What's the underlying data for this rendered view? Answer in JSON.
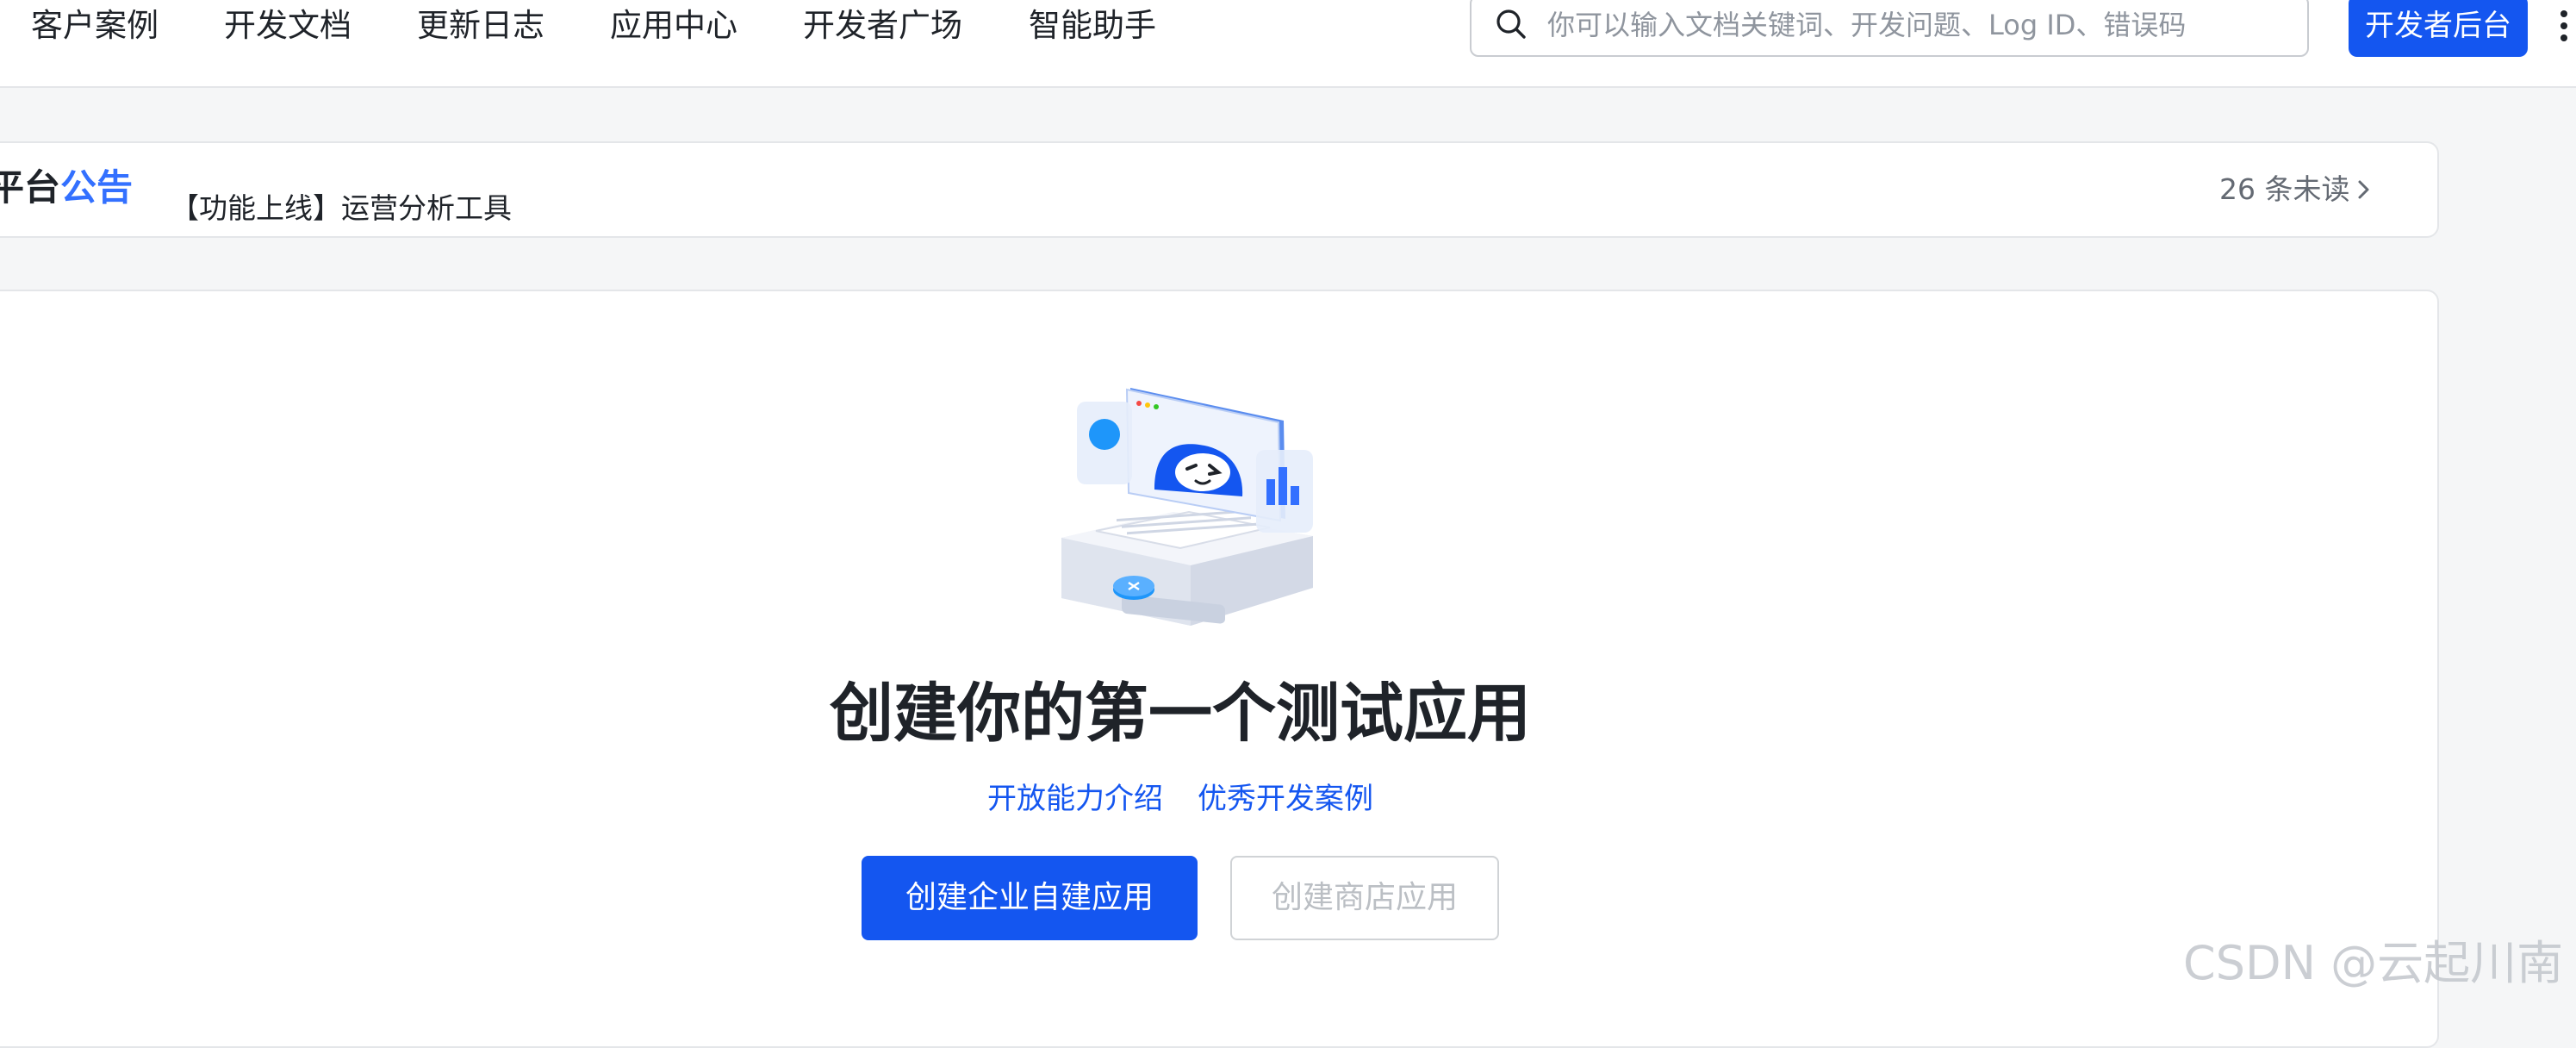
{
  "nav": {
    "items": [
      "客户案例",
      "开发文档",
      "更新日志",
      "应用中心",
      "开发者广场",
      "智能助手"
    ]
  },
  "search": {
    "placeholder": "你可以输入文档关键词、开发问题、Log ID、错误码",
    "value": ""
  },
  "header": {
    "console_label": "开发者后台"
  },
  "announcement": {
    "title_part1": "平台",
    "title_part2": "公告",
    "item": "【功能上线】运营分析工具",
    "unread": "26 条未读"
  },
  "empty_state": {
    "title": "创建你的第一个测试应用",
    "links": [
      "开放能力介绍",
      "优秀开发案例"
    ],
    "primary_button": "创建企业自建应用",
    "secondary_button": "创建商店应用"
  },
  "watermark": "CSDN @云起川南",
  "colors": {
    "brand": "#1456f0",
    "accent_blue": "#3370ff",
    "text_primary": "#1f2329",
    "text_secondary": "#646a73",
    "disabled_text": "#bbbfc4",
    "page_bg": "#f5f6f7"
  },
  "icons": [
    "search-icon",
    "chevron-right-icon",
    "more-vertical-icon"
  ]
}
